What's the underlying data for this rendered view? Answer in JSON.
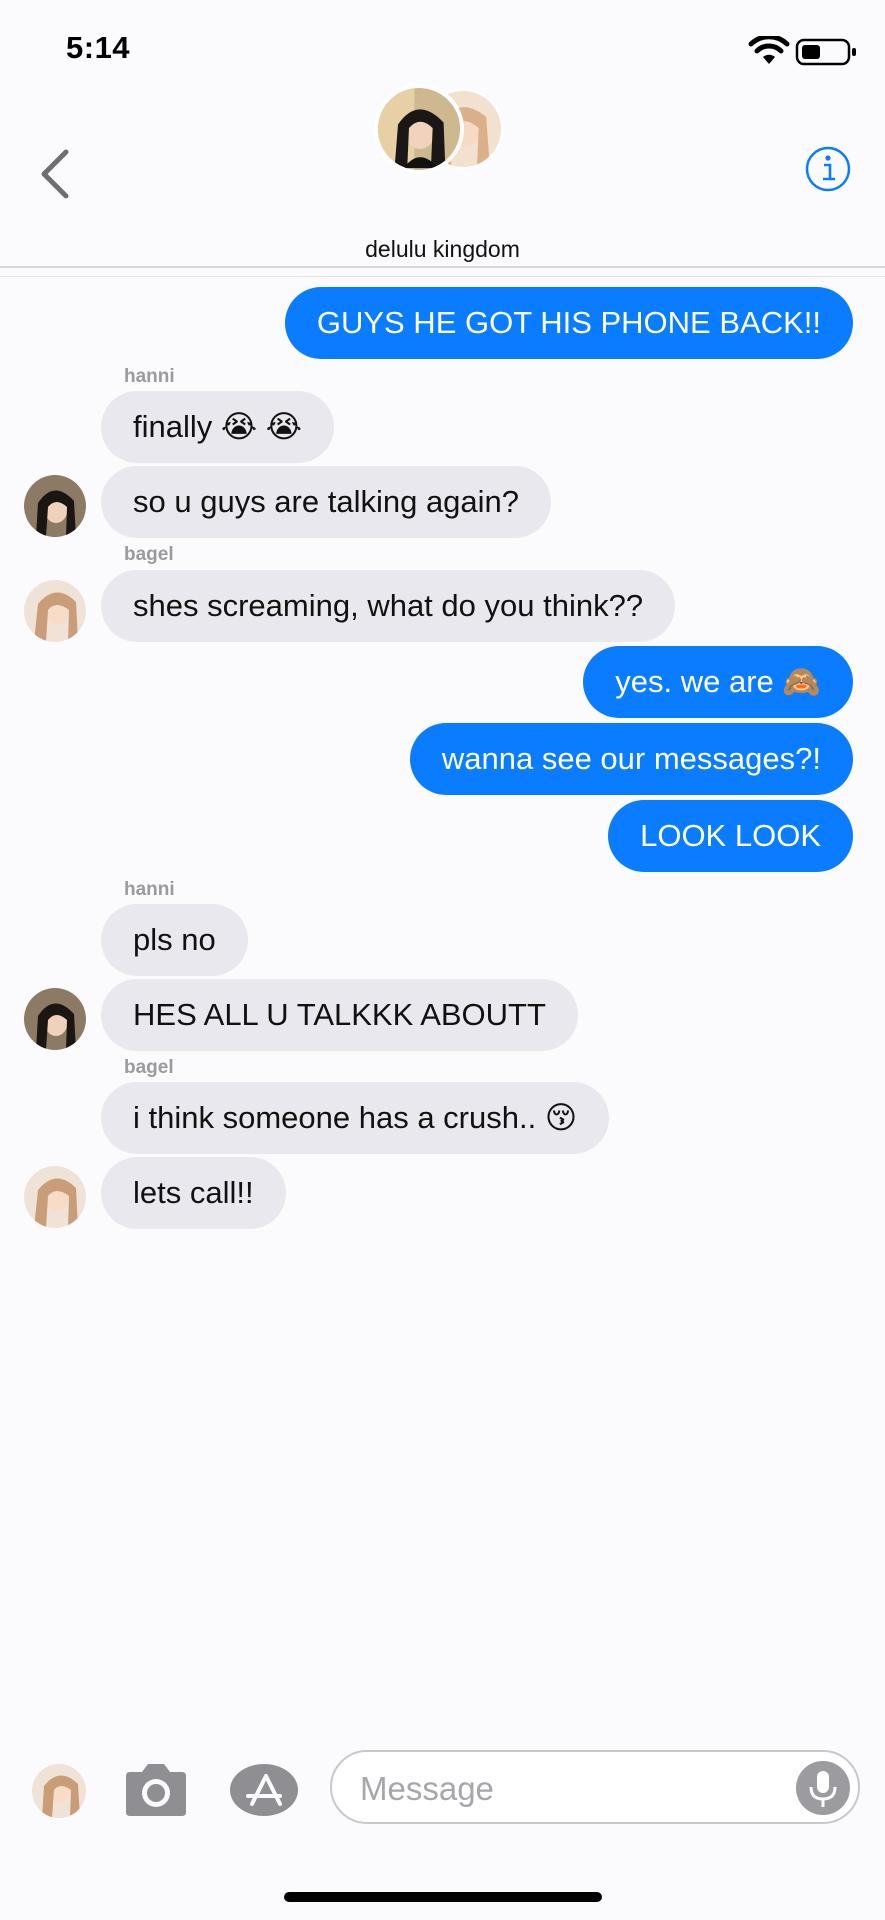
{
  "status": {
    "time": "5:14"
  },
  "header": {
    "group_name": "delulu kingdom"
  },
  "messages": [
    {
      "dir": "out",
      "text": "GUYS HE GOT HIS PHONE BACK!!"
    },
    {
      "sender": "hanni"
    },
    {
      "dir": "in",
      "text": "finally 😭 😭"
    },
    {
      "dir": "in",
      "text": "so u guys are talking again?"
    },
    {
      "sender": "bagel"
    },
    {
      "dir": "in",
      "text": "shes screaming, what do you think??"
    },
    {
      "dir": "out",
      "text": "yes. we are 🙈"
    },
    {
      "dir": "out",
      "text": "wanna see our messages?!"
    },
    {
      "dir": "out",
      "text": "LOOK LOOK"
    },
    {
      "sender": "hanni"
    },
    {
      "dir": "in",
      "text": "pls no"
    },
    {
      "dir": "in",
      "text": "HES ALL U TALKKK ABOUTT"
    },
    {
      "sender": "bagel"
    },
    {
      "dir": "in",
      "text": "i think someone has a crush.. 😚"
    },
    {
      "dir": "in",
      "text": "lets call!!"
    }
  ],
  "composer": {
    "placeholder": "Message"
  },
  "colors": {
    "accent": "#0a7cff",
    "incoming_bubble": "#e9e8ee",
    "background": "#fbfbfd"
  }
}
